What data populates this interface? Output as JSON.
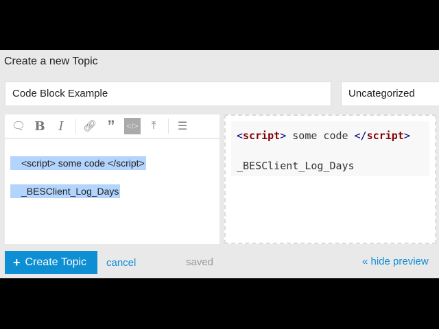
{
  "header": {
    "title": "Create a new Topic"
  },
  "form": {
    "title_value": "Code Block Example",
    "category": "Uncategorized"
  },
  "toolbar": {
    "icons": [
      "speech-bubble-icon",
      "bold-icon",
      "italic-icon",
      "link-icon",
      "quote-icon",
      "code-icon",
      "upload-icon",
      "list-icon"
    ],
    "bold": "B",
    "italic": "I"
  },
  "editor": {
    "lines": [
      "<script> some code </script>",
      "_BESClient_Log_Days"
    ]
  },
  "preview": {
    "open_tag": "<",
    "tag_name": "script",
    "close": ">",
    "middle": " some code ",
    "end_open": "</",
    "line2": "_BESClient_Log_Days"
  },
  "footer": {
    "create_label": "Create Topic",
    "cancel_label": "cancel",
    "status": "saved",
    "hide_preview": "« hide preview"
  },
  "colors": {
    "accent": "#0e8ed3",
    "selection": "#b3d4fc"
  }
}
